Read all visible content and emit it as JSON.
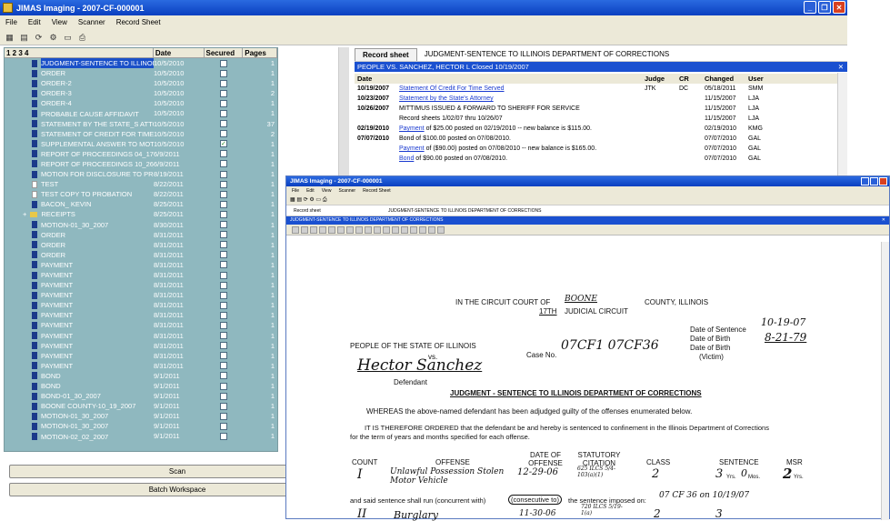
{
  "window": {
    "title": "JIMAS Imaging - 2007-CF-000001"
  },
  "menu": [
    "File",
    "Edit",
    "View",
    "Scanner",
    "Record Sheet"
  ],
  "left": {
    "tabs": "1 2 3 4",
    "headers": [
      "",
      "Date",
      "Secured",
      "Pages"
    ],
    "rows": [
      {
        "name": "JUDGMENT-SENTENCE TO ILLINOIS",
        "date": "10/5/2010",
        "secured": false,
        "pages": "1",
        "sel": true
      },
      {
        "name": "ORDER",
        "date": "10/5/2010",
        "secured": false,
        "pages": "1"
      },
      {
        "name": "ORDER-2",
        "date": "10/5/2010",
        "secured": false,
        "pages": "1"
      },
      {
        "name": "ORDER-3",
        "date": "10/5/2010",
        "secured": false,
        "pages": "2"
      },
      {
        "name": "ORDER-4",
        "date": "10/5/2010",
        "secured": false,
        "pages": "1"
      },
      {
        "name": "PROBABLE CAUSE AFFIDAVIT",
        "date": "10/5/2010",
        "secured": false,
        "pages": "1"
      },
      {
        "name": "STATEMENT BY THE STATE_S ATTO",
        "date": "10/5/2010",
        "secured": false,
        "pages": "37"
      },
      {
        "name": "STATEMENT OF CREDIT FOR TIME S",
        "date": "10/5/2010",
        "secured": false,
        "pages": "2"
      },
      {
        "name": "SUPPLEMENTAL ANSWER TO MOTIC",
        "date": "10/5/2010",
        "secured": true,
        "pages": "1"
      },
      {
        "name": "REPORT OF PROCEEDINGS 04_17_2",
        "date": "6/9/2011",
        "secured": false,
        "pages": "1"
      },
      {
        "name": "REPORT OF PROCEEDINGS 10_26_2",
        "date": "6/9/2011",
        "secured": false,
        "pages": "1"
      },
      {
        "name": "MOTION FOR DISCLOSURE TO PRO",
        "date": "8/19/2011",
        "secured": false,
        "pages": "1"
      },
      {
        "name": "TEST",
        "date": "8/22/2011",
        "secured": false,
        "pages": "1",
        "icon": "blank"
      },
      {
        "name": "TEST COPY TO PROBATION",
        "date": "8/22/2011",
        "secured": false,
        "pages": "1",
        "icon": "blank"
      },
      {
        "name": "BACON_ KEVIN",
        "date": "8/25/2011",
        "secured": false,
        "pages": "1"
      },
      {
        "name": "RECEIPTS",
        "date": "8/25/2011",
        "secured": false,
        "pages": "1",
        "icon": "folder"
      },
      {
        "name": "MOTION-01_30_2007",
        "date": "8/30/2011",
        "secured": false,
        "pages": "1"
      },
      {
        "name": "ORDER",
        "date": "8/31/2011",
        "secured": false,
        "pages": "1"
      },
      {
        "name": "ORDER",
        "date": "8/31/2011",
        "secured": false,
        "pages": "1"
      },
      {
        "name": "ORDER",
        "date": "8/31/2011",
        "secured": false,
        "pages": "1"
      },
      {
        "name": "PAYMENT",
        "date": "8/31/2011",
        "secured": false,
        "pages": "1"
      },
      {
        "name": "PAYMENT",
        "date": "8/31/2011",
        "secured": false,
        "pages": "1"
      },
      {
        "name": "PAYMENT",
        "date": "8/31/2011",
        "secured": false,
        "pages": "1"
      },
      {
        "name": "PAYMENT",
        "date": "8/31/2011",
        "secured": false,
        "pages": "1"
      },
      {
        "name": "PAYMENT",
        "date": "8/31/2011",
        "secured": false,
        "pages": "1"
      },
      {
        "name": "PAYMENT",
        "date": "8/31/2011",
        "secured": false,
        "pages": "1"
      },
      {
        "name": "PAYMENT",
        "date": "8/31/2011",
        "secured": false,
        "pages": "1"
      },
      {
        "name": "PAYMENT",
        "date": "8/31/2011",
        "secured": false,
        "pages": "1"
      },
      {
        "name": "PAYMENT",
        "date": "8/31/2011",
        "secured": false,
        "pages": "1"
      },
      {
        "name": "PAYMENT",
        "date": "8/31/2011",
        "secured": false,
        "pages": "1"
      },
      {
        "name": "PAYMENT",
        "date": "8/31/2011",
        "secured": false,
        "pages": "1"
      },
      {
        "name": "BOND",
        "date": "9/1/2011",
        "secured": false,
        "pages": "1"
      },
      {
        "name": "BOND",
        "date": "9/1/2011",
        "secured": false,
        "pages": "1"
      },
      {
        "name": "BOND-01_30_2007",
        "date": "9/1/2011",
        "secured": false,
        "pages": "1"
      },
      {
        "name": "BOONE COUNTY-10_19_2007",
        "date": "9/1/2011",
        "secured": false,
        "pages": "1"
      },
      {
        "name": "MOTION-01_30_2007",
        "date": "9/1/2011",
        "secured": false,
        "pages": "1"
      },
      {
        "name": "MOTION-01_30_2007",
        "date": "9/1/2011",
        "secured": false,
        "pages": "1"
      },
      {
        "name": "MOTION-02_02_2007",
        "date": "9/1/2011",
        "secured": false,
        "pages": "1"
      }
    ]
  },
  "buttons": {
    "scan": "Scan",
    "batch": "Batch Workspace"
  },
  "record": {
    "tab": "Record sheet",
    "doc_title": "JUDGMENT-SENTENCE TO ILLINOIS DEPARTMENT OF CORRECTIONS",
    "case_line": "PEOPLE VS. SANCHEZ, HECTOR L Closed 10/19/2007",
    "headers": [
      "Date",
      "",
      "Judge",
      "CR",
      "Changed",
      "User"
    ],
    "rows": [
      {
        "date": "10/19/2007",
        "text": "Statement Of Credit For Time Served",
        "link": true,
        "judge": "JTK",
        "cr": "DC",
        "changed": "05/18/2011",
        "user": "SMM"
      },
      {
        "date": "10/23/2007",
        "text": "Statement by the State's Attorney",
        "link": true,
        "judge": "",
        "cr": "",
        "changed": "11/15/2007",
        "user": "LJA"
      },
      {
        "date": "10/26/2007",
        "text": "MITTIMUS ISSUED & FORWARD TO SHERIFF FOR SERVICE",
        "link": false,
        "judge": "",
        "cr": "",
        "changed": "11/15/2007",
        "user": "LJA"
      },
      {
        "date": "",
        "text": "Record sheets 1/02/07 thru 10/26/07",
        "link": false,
        "judge": "",
        "cr": "",
        "changed": "11/15/2007",
        "user": "LJA"
      },
      {
        "date": "02/19/2010",
        "pre": "Payment",
        "text": " of $25.00 posted on 02/19/2010 -- new balance is $115.00.",
        "link": false,
        "judge": "",
        "cr": "",
        "changed": "02/19/2010",
        "user": "KMG"
      },
      {
        "date": "07/07/2010",
        "text": "Bond of $100.00 posted  on 07/08/2010.",
        "link": false,
        "judge": "",
        "cr": "",
        "changed": "07/07/2010",
        "user": "GAL"
      },
      {
        "date": "",
        "pre": "Payment",
        "text": " of ($90.00) posted on 07/08/2010 -- new balance is $165.00.",
        "link": false,
        "judge": "",
        "cr": "",
        "changed": "07/07/2010",
        "user": "GAL"
      },
      {
        "date": "",
        "pre": "Bond",
        "text": " of $90.00 posted  on 07/08/2010.",
        "link": false,
        "judge": "",
        "cr": "",
        "changed": "07/07/2010",
        "user": "GAL"
      }
    ]
  },
  "popup": {
    "title": "JIMAS Imaging - 2007-CF-000001",
    "menu": [
      "File",
      "Edit",
      "View",
      "Scanner",
      "Record Sheet"
    ],
    "tab": "Record sheet",
    "doc_title": "JUDGMENT-SENTENCE TO ILLINOIS DEPARTMENT OF CORRECTIONS",
    "case_line": "JUDGMENT-SENTENCE TO ILLINOIS DEPARTMENT OF CORRECTIONS"
  },
  "document": {
    "court1": "IN THE CIRCUIT COURT OF",
    "county_hw": "BOONE",
    "court2": "COUNTY, ILLINOIS",
    "circuit": "17TH",
    "circuit2": "JUDICIAL CIRCUIT",
    "people": "PEOPLE OF THE STATE OF ILLINOIS",
    "vs": "vs.",
    "defendant_hw": "Hector Sanchez",
    "defendant": "Defendant",
    "caseno": "Case No.",
    "caseno_hw": "07CF1 07CF36",
    "dos": "Date of Sentence",
    "dos_hw": "10-19-07",
    "dob": "Date of Birth",
    "dob_hw": "8-21-79",
    "dob2": "Date of Birth",
    "victim": "(Victim)",
    "heading": "JUDGMENT  -  SENTENCE TO ILLINOIS DEPARTMENT OF CORRECTIONS",
    "whereas": "WHEREAS the above-named defendant has been adjudged guilty of the offenses enumerated below.",
    "ordered": "IT IS THEREFORE ORDERED that the defendant be and hereby is sentenced to confinement in the Illinois Department of Corrections",
    "ordered2": "for the term of years and months specified for each offense.",
    "col_count": "COUNT",
    "col_offense": "OFFENSE",
    "col_date": "DATE OF OFFENSE",
    "col_stat": "STATUTORY CITATION",
    "col_class": "CLASS",
    "col_sentence": "SENTENCE",
    "col_msr": "MSR",
    "r1_count": "I",
    "r1_offense": "Unlawful Possession Stolen Motor Vehicle",
    "r1_date": "12-29-06",
    "r1_stat": "625 ILCS 5/4-103(a)(1)",
    "r1_class": "2",
    "r1_yrs": "3",
    "r1_mos": "0",
    "r1_msr": "2",
    "yrs": "Yrs.",
    "mos": "Mos.",
    "concurrent": "and said sentence shall run  (concurrent with)",
    "consecutive": "(consecutive to)",
    "imposed": "the sentence imposed on:",
    "imposed_hw": "07 CF 36 on 10/19/07",
    "r2_count": "II",
    "r2_offense": "Burglary",
    "r2_date": "11-30-06",
    "r2_stat": "720 ILCS 5/19-1(a)",
    "r2_class": "2",
    "r2_yrs": "3"
  }
}
